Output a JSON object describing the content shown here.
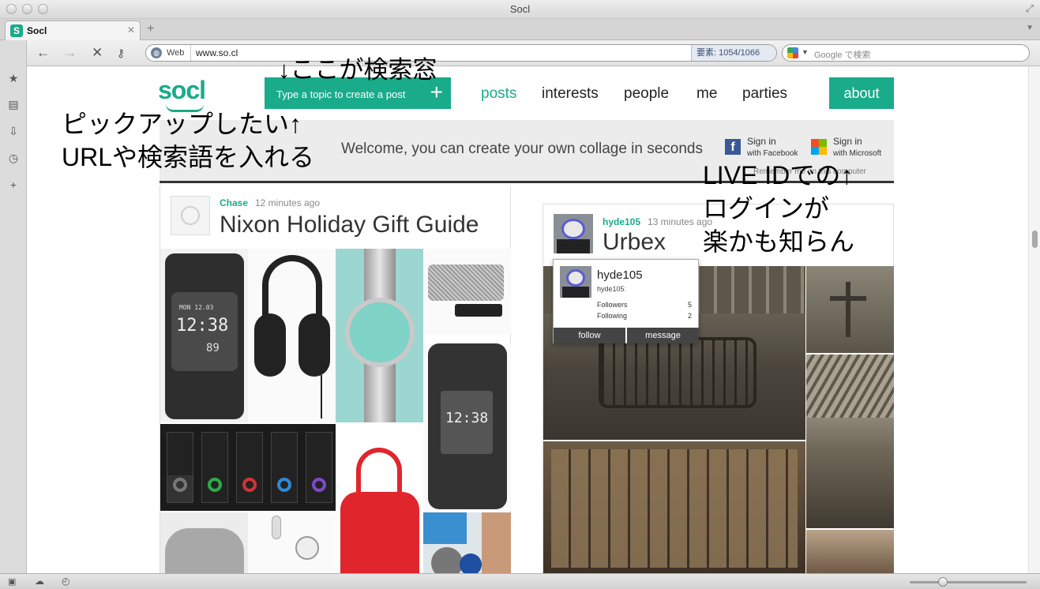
{
  "window": {
    "title": "Socl"
  },
  "tab": {
    "label": "Socl",
    "favicon_letter": "S"
  },
  "browser": {
    "address_label": "Web",
    "url": "www.so.cl",
    "element_count": "要素: 1054/1066",
    "search_placeholder": "Google で検索"
  },
  "site": {
    "logo": "socl",
    "create_post_placeholder": "Type a topic to create a post",
    "nav": [
      "posts",
      "interests",
      "people",
      "me",
      "parties"
    ],
    "about": "about",
    "welcome": "Welcome, you can create your own collage in seconds",
    "facebook_sign_in": "Sign in",
    "facebook_with": "with Facebook",
    "microsoft_sign_in": "Sign in",
    "microsoft_with": "with Microsoft",
    "remember": "Remember me on this computer"
  },
  "posts": [
    {
      "user": "Chase",
      "time": "12 minutes ago",
      "title": "Nixon Holiday Gift Guide"
    },
    {
      "user": "hyde105",
      "time": "13 minutes ago",
      "title": "Urbex"
    }
  ],
  "hovercard": {
    "name": "hyde105",
    "handle": "hyde105ː",
    "followers_label": "Followers",
    "followers": "5",
    "following_label": "Following",
    "following": "2",
    "follow": "follow",
    "message": "message"
  },
  "watch_display": {
    "date": "MON 12.03",
    "time": "12:38",
    "seconds": "89"
  },
  "annotations": {
    "search_note": "↓ここが検索窓",
    "pickup_line1": "ピックアップしたい↑",
    "pickup_line2": "URLや検索語を入れる",
    "live_line1": "LIVE IDでの↑",
    "live_line2": "ログインが",
    "live_line3": "楽かも知らん"
  },
  "colors": {
    "accent": "#1aab8a",
    "facebook": "#3b5998"
  }
}
